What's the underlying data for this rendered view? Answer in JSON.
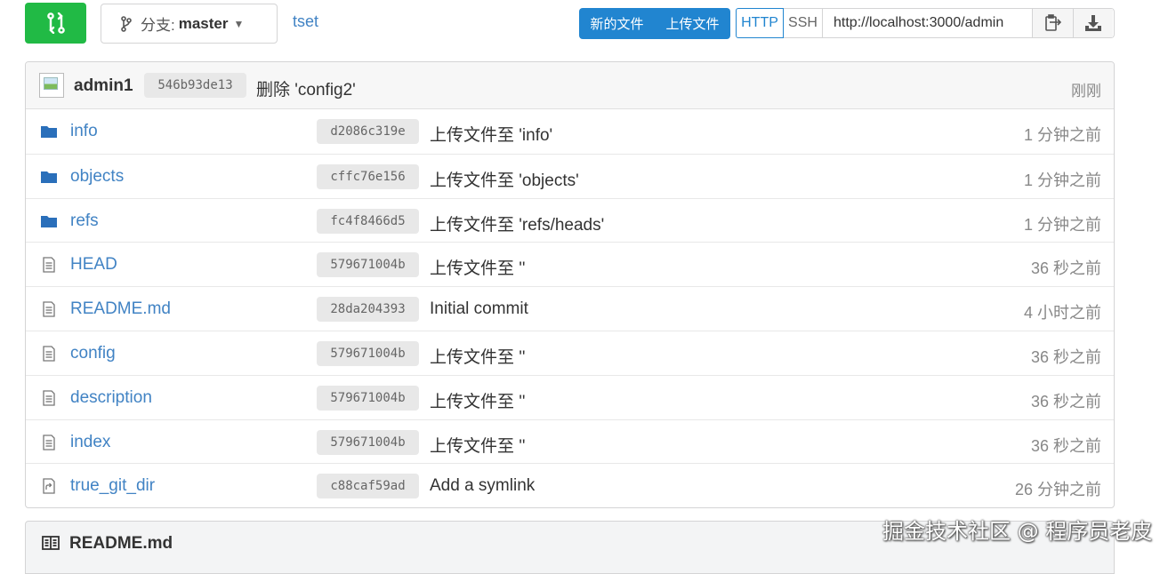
{
  "toolbar": {
    "branch_prefix": "分支:",
    "branch_name": "master",
    "repo_link": "tset",
    "new_file": "新的文件",
    "upload_file": "上传文件",
    "http": "HTTP",
    "ssh": "SSH",
    "clone_url": "http://localhost:3000/admin"
  },
  "latest_commit": {
    "author": "admin1",
    "sha": "546b93de13",
    "message": "删除 'config2'",
    "time": "刚刚"
  },
  "files": [
    {
      "name": "info",
      "type": "folder",
      "sha": "d2086c319e",
      "message": "上传文件至 'info'",
      "time": "1 分钟之前"
    },
    {
      "name": "objects",
      "type": "folder",
      "sha": "cffc76e156",
      "message": "上传文件至 'objects'",
      "time": "1 分钟之前"
    },
    {
      "name": "refs",
      "type": "folder",
      "sha": "fc4f8466d5",
      "message": "上传文件至 'refs/heads'",
      "time": "1 分钟之前"
    },
    {
      "name": "HEAD",
      "type": "file",
      "sha": "579671004b",
      "message": "上传文件至 ''",
      "time": "36 秒之前"
    },
    {
      "name": "README.md",
      "type": "file",
      "sha": "28da204393",
      "message": "Initial commit",
      "time": "4 小时之前"
    },
    {
      "name": "config",
      "type": "file",
      "sha": "579671004b",
      "message": "上传文件至 ''",
      "time": "36 秒之前"
    },
    {
      "name": "description",
      "type": "file",
      "sha": "579671004b",
      "message": "上传文件至 ''",
      "time": "36 秒之前"
    },
    {
      "name": "index",
      "type": "file",
      "sha": "579671004b",
      "message": "上传文件至 ''",
      "time": "36 秒之前"
    },
    {
      "name": "true_git_dir",
      "type": "symlink",
      "sha": "c88caf59ad",
      "message": "Add a symlink",
      "time": "26 分钟之前"
    }
  ],
  "readme": {
    "title": "README.md"
  },
  "watermark": "掘金技术社区 @ 程序员老皮",
  "colors": {
    "accent_blue": "#2185d0",
    "link_blue": "#4183c4",
    "green": "#21ba45"
  }
}
